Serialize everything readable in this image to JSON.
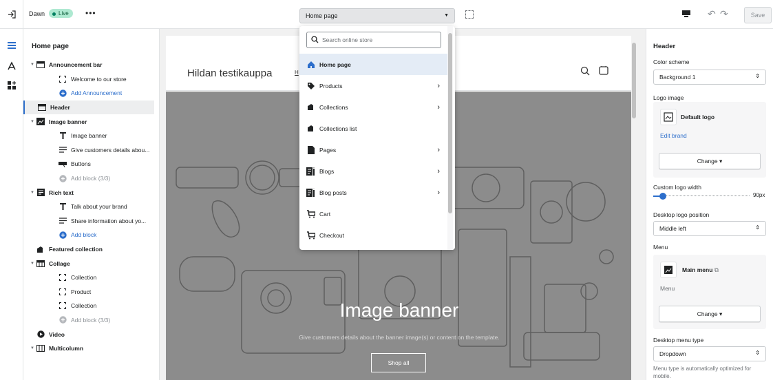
{
  "topbar": {
    "theme_name": "Dawn",
    "live_label": "Live",
    "more_label": "•••",
    "page_select": "Home page",
    "save_label": "Save"
  },
  "sidebar": {
    "title": "Home page",
    "items": [
      {
        "label": "Announcement bar",
        "type": "section",
        "icon": "announcement-icon"
      },
      {
        "label": "Welcome to our store",
        "type": "block",
        "icon": "block-icon"
      },
      {
        "label": "Add Announcement",
        "type": "add",
        "icon": "add-circle-icon"
      },
      {
        "label": "Header",
        "type": "section-selected",
        "icon": "header-icon"
      },
      {
        "label": "Image banner",
        "type": "section",
        "icon": "image-icon"
      },
      {
        "label": "Image banner",
        "type": "block",
        "icon": "text-icon"
      },
      {
        "label": "Give customers details abou...",
        "type": "block",
        "icon": "paragraph-icon"
      },
      {
        "label": "Buttons",
        "type": "block",
        "icon": "button-icon"
      },
      {
        "label": "Add block (3/3)",
        "type": "add-disabled",
        "icon": "add-circle-icon"
      },
      {
        "label": "Rich text",
        "type": "section",
        "icon": "rich-text-icon"
      },
      {
        "label": "Talk about your brand",
        "type": "block",
        "icon": "text-icon"
      },
      {
        "label": "Share information about yo...",
        "type": "block",
        "icon": "paragraph-icon"
      },
      {
        "label": "Add block",
        "type": "add",
        "icon": "add-circle-icon"
      },
      {
        "label": "Featured collection",
        "type": "section-noarrow",
        "icon": "collection-icon"
      },
      {
        "label": "Collage",
        "type": "section",
        "icon": "collage-icon"
      },
      {
        "label": "Collection",
        "type": "block",
        "icon": "block-icon"
      },
      {
        "label": "Product",
        "type": "block",
        "icon": "block-icon"
      },
      {
        "label": "Collection",
        "type": "block",
        "icon": "block-icon"
      },
      {
        "label": "Add block (3/3)",
        "type": "add-disabled",
        "icon": "add-circle-icon"
      },
      {
        "label": "Video",
        "type": "section-noarrow",
        "icon": "video-icon"
      },
      {
        "label": "Multicolumn",
        "type": "section",
        "icon": "columns-icon"
      }
    ]
  },
  "preview": {
    "store_name": "Hildan testikauppa",
    "store_link": "H",
    "banner_title": "Image banner",
    "banner_subtitle": "Give customers details about the banner image(s) or content on the template.",
    "banner_button": "Shop all"
  },
  "dropdown": {
    "search_placeholder": "Search online store",
    "items": [
      {
        "label": "Home page",
        "icon": "home-icon",
        "chevron": false,
        "active": true
      },
      {
        "label": "Products",
        "icon": "tag-icon",
        "chevron": true
      },
      {
        "label": "Collections",
        "icon": "collection-icon",
        "chevron": true
      },
      {
        "label": "Collections list",
        "icon": "collection-icon",
        "chevron": false
      },
      {
        "label": "Pages",
        "icon": "page-icon",
        "chevron": true
      },
      {
        "label": "Blogs",
        "icon": "blog-icon",
        "chevron": true
      },
      {
        "label": "Blog posts",
        "icon": "blog-icon",
        "chevron": true
      },
      {
        "label": "Cart",
        "icon": "cart-icon",
        "chevron": false
      },
      {
        "label": "Checkout",
        "icon": "cart-icon",
        "chevron": false
      }
    ]
  },
  "settings": {
    "title": "Header",
    "color_scheme_label": "Color scheme",
    "color_scheme_value": "Background 1",
    "logo_image_label": "Logo image",
    "logo_name": "Default logo",
    "edit_brand": "Edit brand",
    "change_label": "Change",
    "custom_logo_width_label": "Custom logo width",
    "custom_logo_width_value": "90px",
    "custom_logo_width_fraction": 0.1,
    "desktop_logo_position_label": "Desktop logo position",
    "desktop_logo_position_value": "Middle left",
    "menu_label": "Menu",
    "menu_name": "Main menu",
    "menu_sub": "Menu",
    "desktop_menu_type_label": "Desktop menu type",
    "desktop_menu_type_value": "Dropdown",
    "menu_type_help": "Menu type is automatically optimized for mobile."
  },
  "colors": {
    "accent": "#2c6ecb",
    "live_badge": "#aee9d1",
    "banner_bg": "#8c8c8c"
  }
}
